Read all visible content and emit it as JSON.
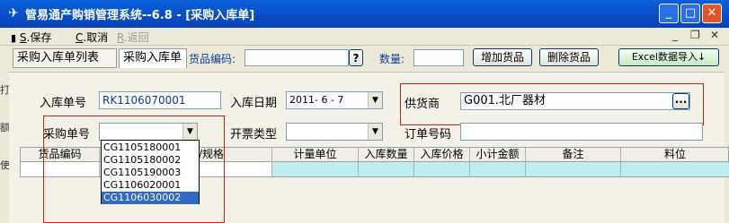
{
  "window": {
    "title": "管易通产购销管理系统--6.8 - [采购入库单]",
    "controls": {
      "minimize": "_",
      "maximize": "□",
      "close": "✕"
    }
  },
  "menu": {
    "save": {
      "key": "S",
      "label": ".保存"
    },
    "cancel": {
      "key": "C",
      "label": ".取消"
    },
    "back": {
      "key": "R",
      "label": ".返回"
    },
    "mdi_controls": {
      "minimize": "_",
      "restore": "❐",
      "close": "✕"
    }
  },
  "tabs": [
    {
      "label": "采购入库单列表"
    },
    {
      "label": "采购入库单"
    }
  ],
  "toolbar": {
    "product_code_label": "货品编码:",
    "product_code_value": "",
    "query_button": "?",
    "quantity_label": "数量:",
    "quantity_value": "",
    "add_button": "增加货品",
    "delete_button": "删除货品",
    "excel_button": "Excel数据导入↓"
  },
  "form": {
    "receipt_no_label": "入库单号",
    "receipt_no_value": "RK1106070001",
    "date_label": "入库日期",
    "date_value": "2011- 6 - 7",
    "supplier_label": "供货商",
    "supplier_value": "G001.北厂器材",
    "supplier_browse": "...",
    "po_no_label": "采购单号",
    "po_no_value": "",
    "invoice_type_label": "开票类型",
    "invoice_type_value": "",
    "order_no_label": "订单号码",
    "order_no_value": ""
  },
  "grid": {
    "columns": [
      "货品编码",
      "/规格",
      "计量单位",
      "入库数量",
      "入库价格",
      "小计金额",
      "备注",
      "料位"
    ]
  },
  "po_dropdown": {
    "options": [
      "CG1105180001",
      "CG1105180002",
      "CG1105190003",
      "CG1106020001",
      "CG1106030002"
    ],
    "selected_index": 4
  },
  "left_edge": {
    "chars": [
      "打",
      "额",
      "使"
    ]
  },
  "colors": {
    "titlebar": "#0a5fd8",
    "highlight": "#316ac5",
    "grid_cell": "#bfeef0",
    "callout": "#d02020"
  }
}
